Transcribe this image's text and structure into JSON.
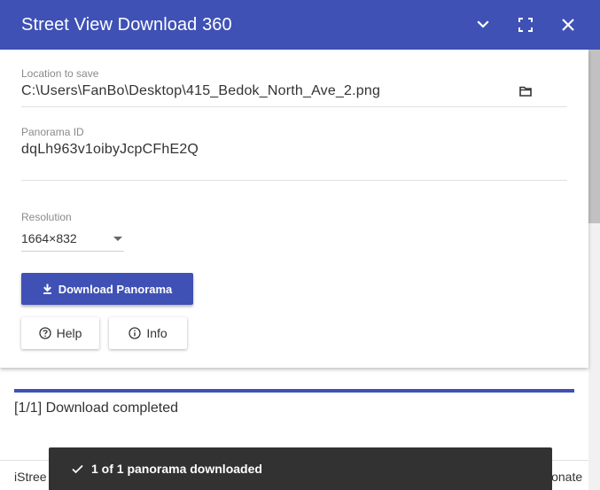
{
  "window": {
    "title": "Street View Download 360",
    "accent_color": "#3f51b5"
  },
  "form": {
    "location": {
      "label": "Location to save",
      "value": "C:\\Users\\FanBo\\Desktop\\415_Bedok_North_Ave_2.png",
      "browse_icon": "folder-icon"
    },
    "panorama_id": {
      "label": "Panorama ID",
      "value": "dqLh963v1oibyJcpCFhE2Q"
    },
    "resolution": {
      "label": "Resolution",
      "selected": "1664×832"
    }
  },
  "actions": {
    "download_label": "Download Panorama",
    "help_label": "Help",
    "info_label": "Info"
  },
  "progress": {
    "fraction": 1.0,
    "status_text": "[1/1] Download completed"
  },
  "footer": {
    "left_text": "iStree",
    "right_text": "Donate"
  },
  "snackbar": {
    "message": "1 of 1 panorama downloaded"
  }
}
